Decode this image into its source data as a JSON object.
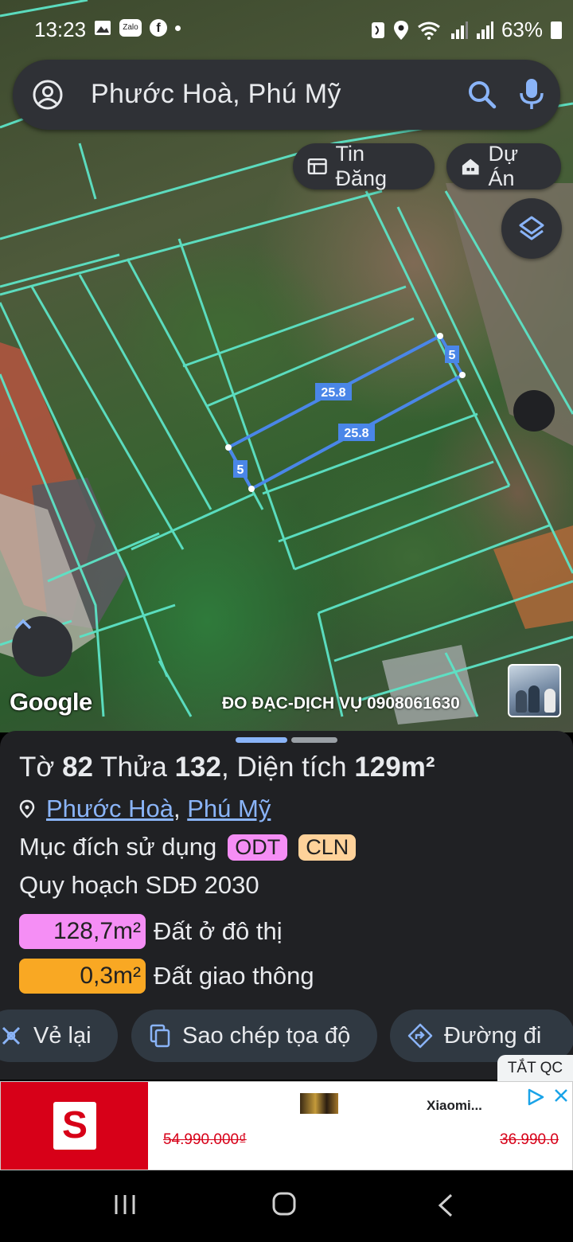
{
  "status_bar": {
    "time": "13:23",
    "battery": "63%",
    "icons": [
      "gallery-icon",
      "zalo-icon",
      "facebook-icon",
      "dot-icon",
      "nfc-icon",
      "location-icon",
      "wifi-icon",
      "signal-icon",
      "signal-icon",
      "battery-icon"
    ],
    "zalo_label": "Zalo",
    "facebook_label": "f"
  },
  "search": {
    "value": "Phước Hoà, Phú Mỹ",
    "icons": [
      "account-icon",
      "search-icon",
      "mic-icon"
    ]
  },
  "chips": [
    {
      "label": "Tin Đăng",
      "icon": "listing-icon"
    },
    {
      "label": "Dự Án",
      "icon": "project-icon"
    }
  ],
  "map": {
    "edge_labels": {
      "top": "25.8",
      "bottom": "25.8",
      "left": "5",
      "right": "5"
    },
    "google_logo": "Google",
    "attribution": "ĐO ĐẠC-DỊCH VỤ 0908061630",
    "line_color": "#5de3c6",
    "parcel_color": "#4a86e8"
  },
  "sheet": {
    "title_prefix": "Tờ",
    "sheet_no": "82",
    "plot_prefix": "Thửa",
    "plot_no": "132",
    "area_prefix": ", Diện tích",
    "area": "129m²",
    "location_1": "Phước Hoà",
    "location_sep": ",",
    "location_2": "Phú Mỹ",
    "purpose_label": "Mục đích sử dụng",
    "badges": [
      {
        "label": "ODT",
        "color": "#f58ef5"
      },
      {
        "label": "CLN",
        "color": "#fed29a"
      }
    ],
    "plan_label": "Quy hoạch SDĐ 2030",
    "zones": [
      {
        "area": "128,7m²",
        "label": "Đất ở đô thị",
        "color": "#f58ef5"
      },
      {
        "area": "0,3m²",
        "label": "Đất giao thông",
        "color": "#f9a823"
      }
    ],
    "actions": [
      {
        "label": "Vẻ lại",
        "icon": "redraw-icon"
      },
      {
        "label": "Sao chép tọa độ",
        "icon": "copy-icon"
      },
      {
        "label": "Đường đi",
        "icon": "directions-icon"
      }
    ]
  },
  "ad": {
    "dismiss_label": "TẮT QC",
    "brand_letter": "S",
    "product_name": "Xiaomi...",
    "old_price_1": "54.990.000₫",
    "old_price_2": "36.990.0"
  },
  "navbar": {
    "icons": [
      "recent-apps-icon",
      "home-icon",
      "back-icon"
    ]
  }
}
